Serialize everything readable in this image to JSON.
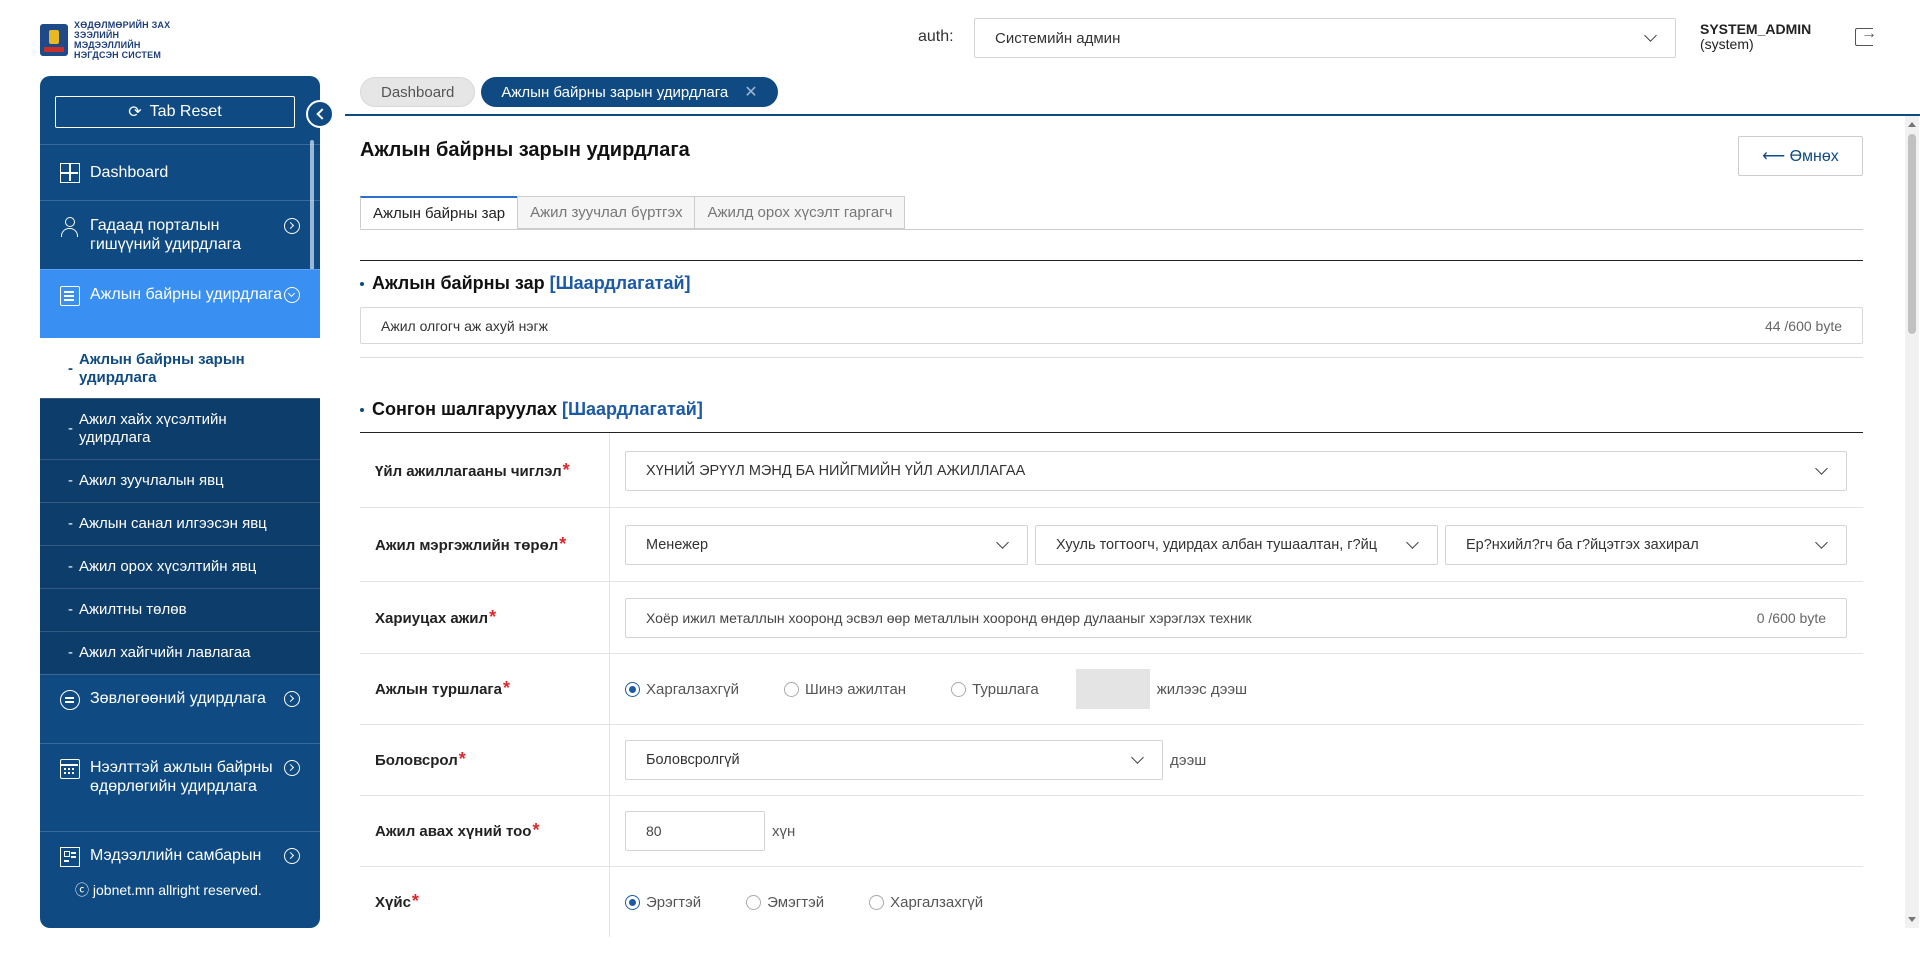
{
  "header": {
    "logo_text": "ХӨДӨЛМӨРИЙН ЗАХ ЗЭЭЛИЙН МЭДЭЭЛЛИЙН НЭГДСЭН СИСТЕМ",
    "auth_label": "auth:",
    "auth_value": "Системийн админ",
    "user_name": "SYSTEM_ADMIN",
    "user_role": "(system)"
  },
  "sidebar": {
    "tab_reset": "Tab Reset",
    "items": [
      {
        "label": "Dashboard",
        "icon": "dashboard-icon"
      },
      {
        "label": "Гадаад порталын гишүүний удирдлага",
        "icon": "user-icon"
      },
      {
        "label": "Ажлын байрны удирдлага",
        "icon": "document-icon"
      },
      {
        "label": "Зөвлөгөөний удирдлага",
        "icon": "chat-icon"
      },
      {
        "label": "Нээлттэй ажлын байрны өдөрлөгийн удирдлага",
        "icon": "calendar-icon"
      },
      {
        "label": "Мэдээллийн самбарын",
        "icon": "board-icon"
      }
    ],
    "subitems": [
      "Ажлын байрны зарын удирдлага",
      "Ажил хайх хүсэлтийн удирдлага",
      "Ажил зуучлалын явц",
      "Ажлын санал илгээсэн явц",
      "Ажил орох хүсэлтийн явц",
      "Ажилтны төлөв",
      "Ажил хайгчийн лавлагаа"
    ],
    "subitem_prefix": "-",
    "copyright": "ⓒ jobnet.mn allright reserved."
  },
  "tabs": {
    "dashboard": "Dashboard",
    "current": "Ажлын байрны зарын удирдлага",
    "close": "✕"
  },
  "main": {
    "title": "Ажлын байрны зарын удирдлага",
    "back": "⟵ Өмнөх",
    "subtabs": [
      "Ажлын байрны зар",
      "Ажил зуучлал бүртгэх",
      "Ажилд орох хүсэлт гаргагч"
    ],
    "section1": {
      "title": "Ажлын байрны зар",
      "required": "[Шаардлагатай]"
    },
    "employer_field": {
      "value": "Ажил олгогч аж ахуй нэгж",
      "count": "44 /600 byte"
    },
    "section2": {
      "title": "Сонгон шалгаруулах",
      "required": "[Шаардлагатай]"
    },
    "star": "*",
    "form": {
      "activity": {
        "label": "Үйл ажиллагааны чиглэл",
        "value": "ХҮНИЙ ЭРҮҮЛ МЭНД БА НИЙГМИЙН ҮЙЛ АЖИЛЛАГАА"
      },
      "profession": {
        "label": "Ажил мэргэжлийн төрөл",
        "values": [
          "Менежер",
          "Хууль тогтоогч, удирдах албан тушаалтан, г?йц",
          "Ер?нхийл?гч ба г?йцэтгэх захирал"
        ]
      },
      "duty": {
        "label": "Хариуцах ажил",
        "value": "Хоёр ижил металлын хооронд эсвэл өөр  металлын хооронд өндөр дулааныг хэрэглэх техник",
        "count": "0 /600 byte"
      },
      "experience": {
        "label": "Ажлын туршлага",
        "options": [
          "Харгалзахгүй",
          "Шинэ ажилтан",
          "Туршлага"
        ],
        "selected": "Харгалзахгүй",
        "suffix": "жилээс дээш"
      },
      "education": {
        "label": "Боловсрол",
        "value": "Боловсролгүй",
        "suffix": "дээш"
      },
      "headcount": {
        "label": "Ажил авах хүний тоо",
        "value": "80",
        "suffix": "хүн"
      },
      "gender": {
        "label": "Хүйс",
        "options": [
          "Эрэгтэй",
          "Эмэгтэй",
          "Харгалзахгүй"
        ],
        "selected": "Эрэгтэй"
      }
    }
  },
  "colors": {
    "brand": "#0f4b82",
    "active_menu": "#3a8ff2",
    "required_star": "#e0262d"
  }
}
